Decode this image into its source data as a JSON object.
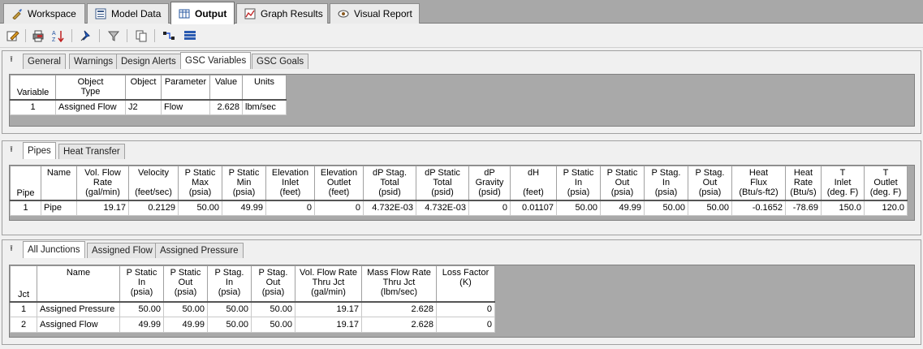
{
  "main_tabs": [
    {
      "label": "Workspace",
      "icon": "workspace-icon"
    },
    {
      "label": "Model Data",
      "icon": "model-data-icon"
    },
    {
      "label": "Output",
      "icon": "output-icon"
    },
    {
      "label": "Graph Results",
      "icon": "graph-icon"
    },
    {
      "label": "Visual Report",
      "icon": "eye-icon"
    }
  ],
  "toolbar": {
    "icons": [
      "edit-output-icon",
      "print-icon",
      "sort-icon",
      "pin-icon",
      "filter-icon",
      "copy-icon",
      "connect-icon",
      "layout-icon"
    ]
  },
  "gsc_panel": {
    "tabs": [
      "General",
      "Warnings",
      "Design Alerts",
      "GSC Variables",
      "GSC Goals"
    ],
    "active_tab": "GSC Variables",
    "columns": [
      [
        "Variable"
      ],
      [
        "Object",
        "Type"
      ],
      [
        "Object"
      ],
      [
        "Parameter"
      ],
      [
        "Value"
      ],
      [
        "Units"
      ]
    ],
    "rows": [
      [
        "1",
        "Assigned Flow",
        "J2",
        "Flow",
        "2.628",
        "lbm/sec"
      ]
    ]
  },
  "pipes_panel": {
    "tabs": [
      "Pipes",
      "Heat Transfer"
    ],
    "active_tab": "Pipes",
    "columns": [
      [
        "Pipe"
      ],
      [
        "Name"
      ],
      [
        "Vol. Flow",
        "Rate",
        "(gal/min)"
      ],
      [
        "Velocity",
        "",
        "(feet/sec)"
      ],
      [
        "P Static",
        "Max",
        "(psia)"
      ],
      [
        "P Static",
        "Min",
        "(psia)"
      ],
      [
        "Elevation",
        "Inlet",
        "(feet)"
      ],
      [
        "Elevation",
        "Outlet",
        "(feet)"
      ],
      [
        "dP Stag.",
        "Total",
        "(psid)"
      ],
      [
        "dP Static",
        "Total",
        "(psid)"
      ],
      [
        "dP",
        "Gravity",
        "(psid)"
      ],
      [
        "dH",
        "",
        "(feet)"
      ],
      [
        "P Static",
        "In",
        "(psia)"
      ],
      [
        "P Static",
        "Out",
        "(psia)"
      ],
      [
        "P Stag.",
        "In",
        "(psia)"
      ],
      [
        "P Stag.",
        "Out",
        "(psia)"
      ],
      [
        "Heat",
        "Flux",
        "(Btu/s-ft2)"
      ],
      [
        "Heat",
        "Rate",
        "(Btu/s)"
      ],
      [
        "T",
        "Inlet",
        "(deg. F)"
      ],
      [
        "T",
        "Outlet",
        "(deg. F)"
      ]
    ],
    "rows": [
      [
        "1",
        "Pipe",
        "19.17",
        "0.2129",
        "50.00",
        "49.99",
        "0",
        "0",
        "4.732E-03",
        "4.732E-03",
        "0",
        "0.01107",
        "50.00",
        "49.99",
        "50.00",
        "50.00",
        "-0.1652",
        "-78.69",
        "150.0",
        "120.0"
      ]
    ]
  },
  "junctions_panel": {
    "tabs": [
      "All Junctions",
      "Assigned Flow",
      "Assigned Pressure"
    ],
    "active_tab": "All Junctions",
    "columns": [
      [
        "Jct"
      ],
      [
        "Name"
      ],
      [
        "P Static",
        "In",
        "(psia)"
      ],
      [
        "P Static",
        "Out",
        "(psia)"
      ],
      [
        "P Stag.",
        "In",
        "(psia)"
      ],
      [
        "P Stag.",
        "Out",
        "(psia)"
      ],
      [
        "Vol. Flow Rate",
        "Thru Jct",
        "(gal/min)"
      ],
      [
        "Mass Flow Rate",
        "Thru Jct",
        "(lbm/sec)"
      ],
      [
        "Loss Factor",
        "(K)"
      ]
    ],
    "rows": [
      [
        "1",
        "Assigned Pressure",
        "50.00",
        "50.00",
        "50.00",
        "50.00",
        "19.17",
        "2.628",
        "0"
      ],
      [
        "2",
        "Assigned Flow",
        "49.99",
        "49.99",
        "50.00",
        "50.00",
        "19.17",
        "2.628",
        "0"
      ]
    ]
  }
}
